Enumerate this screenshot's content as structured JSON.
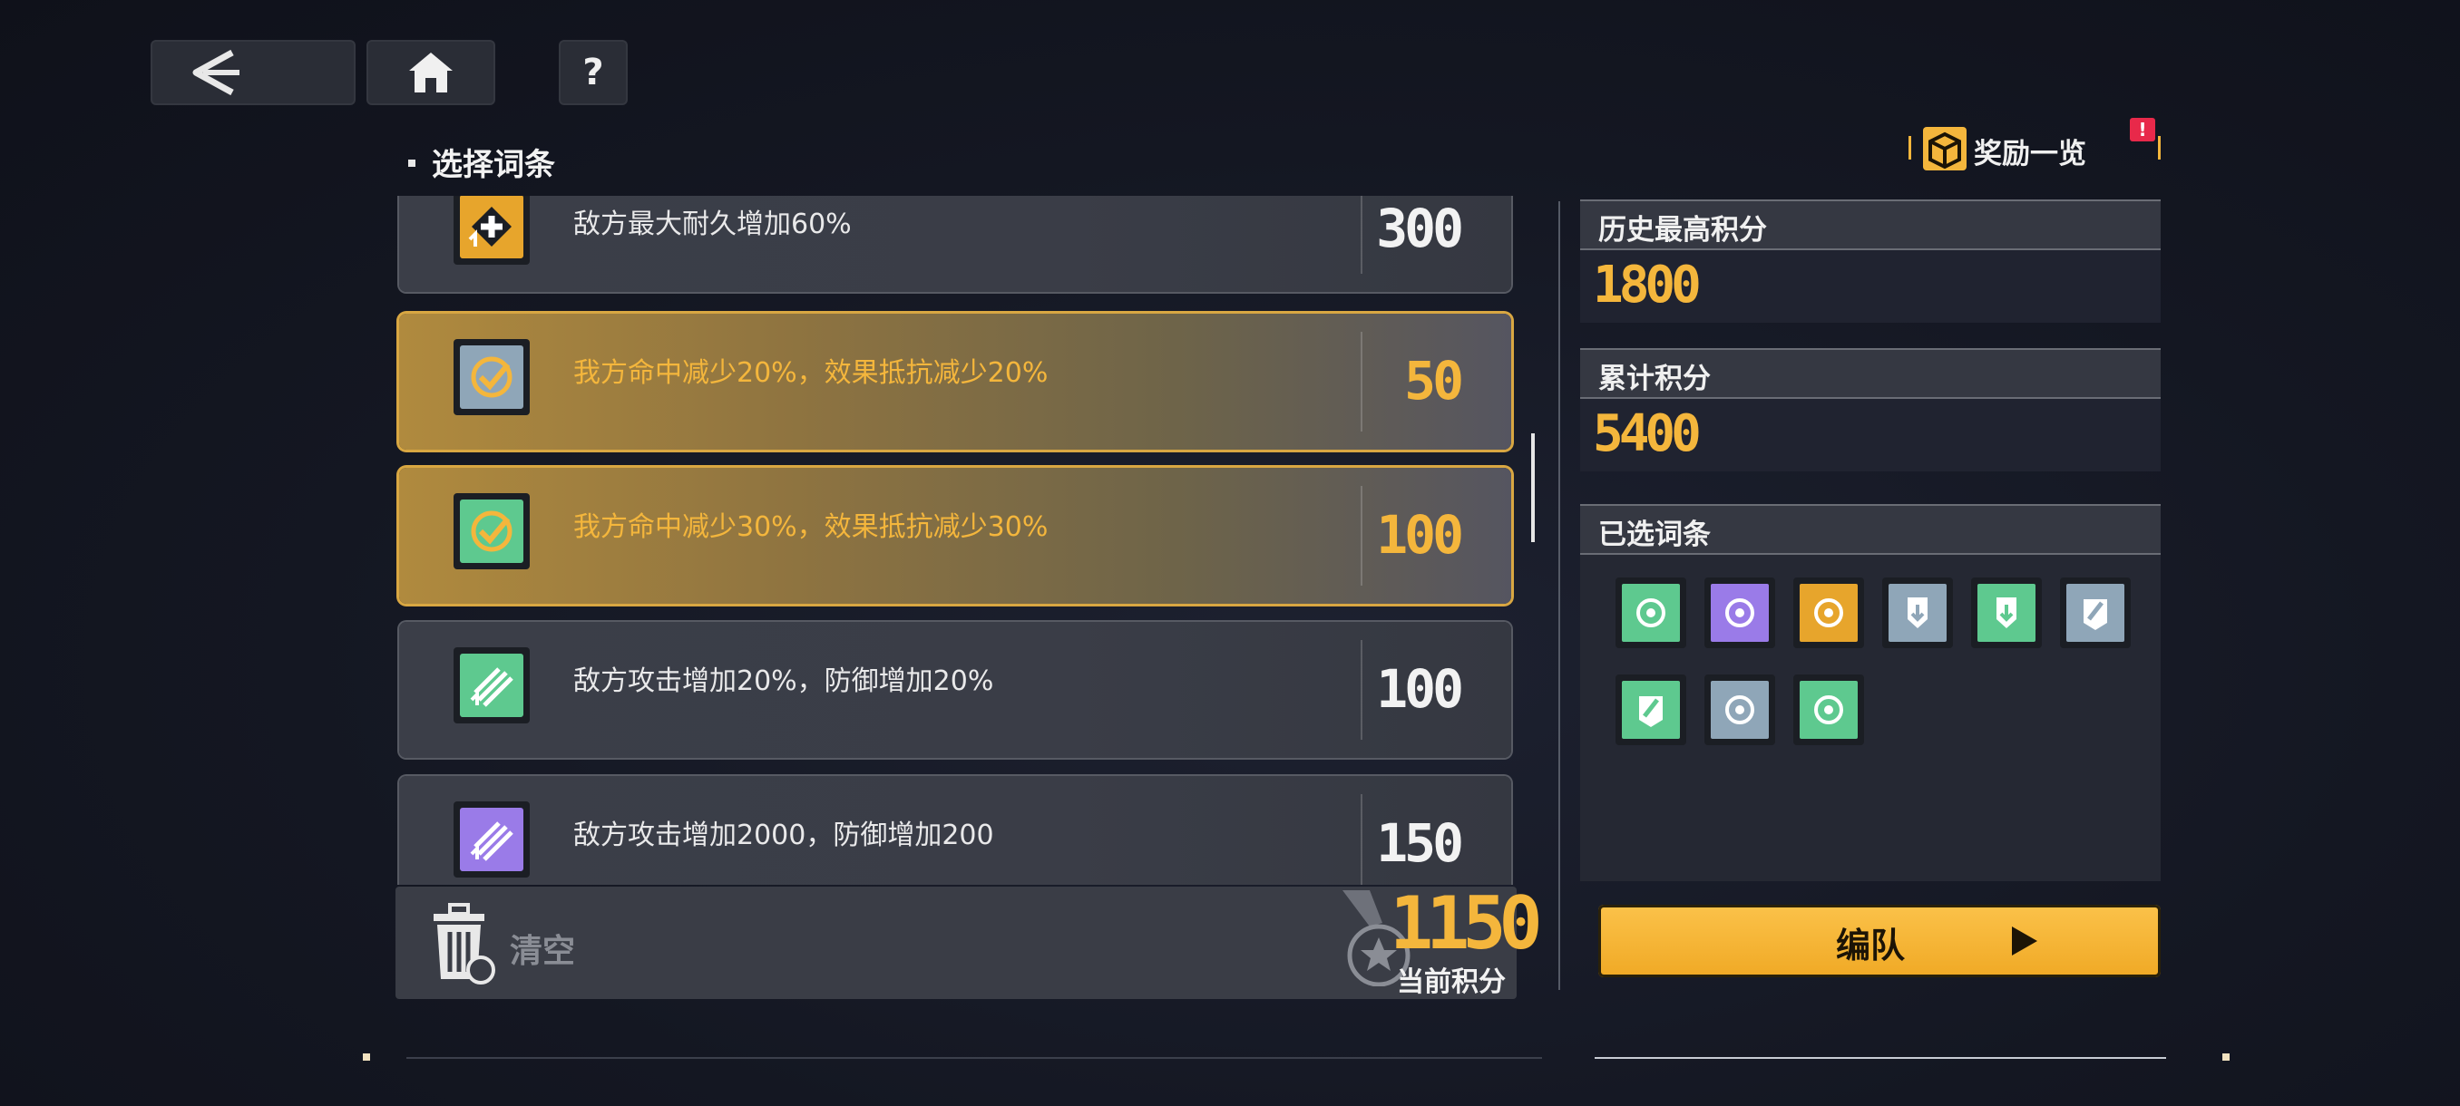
{
  "nav": {
    "back_label": "<",
    "help_label": "?"
  },
  "section_title": "选择词条",
  "rows": [
    {
      "text": "敌方最大耐久增加60%",
      "points": "300",
      "selected": false,
      "icon": "max-hp-up-icon",
      "color": "#e7a52c"
    },
    {
      "text": "我方命中减少20%，效果抵抗减少20%",
      "points": "50",
      "selected": true,
      "icon": "accuracy-down-icon",
      "color": "#8fa6b8"
    },
    {
      "text": "我方命中减少30%，效果抵抗减少30%",
      "points": "100",
      "selected": true,
      "icon": "accuracy-down-icon",
      "color": "#5ec98f"
    },
    {
      "text": "敌方攻击增加20%，防御增加20%",
      "points": "100",
      "selected": false,
      "icon": "attack-up-icon",
      "color": "#5ec98f"
    },
    {
      "text": "敌方攻击增加2000，防御增加200",
      "points": "150",
      "selected": false,
      "icon": "attack-up-icon",
      "color": "#9a7be8"
    }
  ],
  "bottom": {
    "clear_label": "清空",
    "current_score": "1150",
    "current_score_label": "当前积分"
  },
  "right": {
    "reward_label": "奖励一览",
    "reward_badge": "!",
    "history_label": "历史最高积分",
    "history_value": "1800",
    "total_label": "累计积分",
    "total_value": "5400",
    "selected_label": "已选词条",
    "chips": [
      "#5ec98f",
      "#9a7be8",
      "#e7a52c",
      "#8fa6b8",
      "#5ec98f",
      "#8fa6b8",
      "#5ec98f",
      "#8fa6b8",
      "#5ec98f"
    ],
    "team_label": "编队"
  },
  "colors": {
    "accent": "#f4b63c",
    "panel": "#3a3d46"
  }
}
